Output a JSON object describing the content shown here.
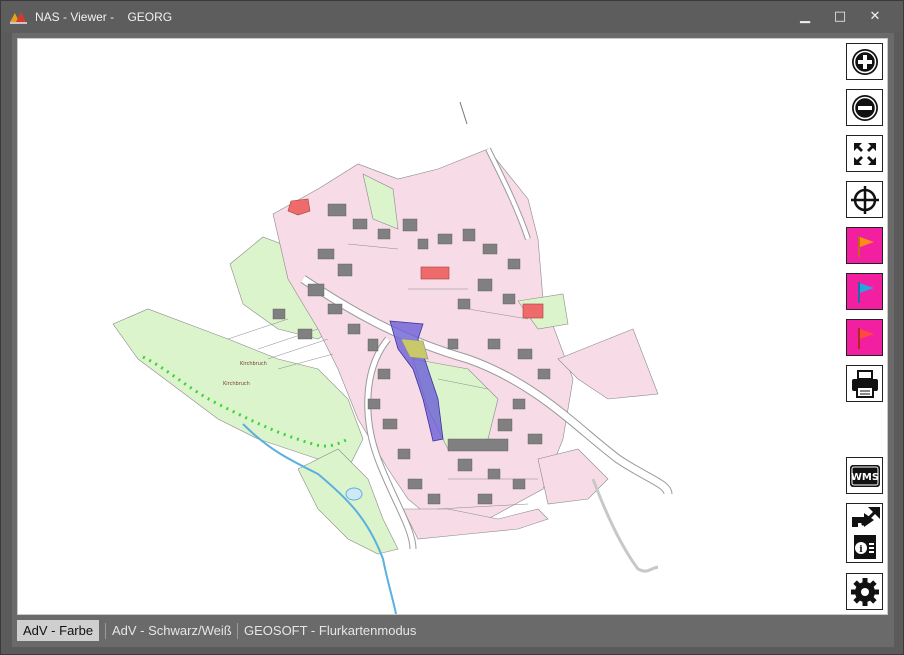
{
  "window": {
    "title": "NAS - Viewer -    GEORG",
    "minimize_glyph": "▁",
    "maximize_glyph": "□",
    "close_glyph": "✕"
  },
  "map": {
    "labels": {
      "field_1": "Kirchbruch",
      "field_2": "Kirchbruch"
    },
    "colors": {
      "residential": "#f7dbe6",
      "green": "#dcf4cc",
      "building": "#808080",
      "public_building": "#ef6b6b",
      "road": "#ffffff",
      "highlight": "#6b5fd6",
      "water": "#5ab0e0",
      "hedge": "#39d639"
    }
  },
  "toolbar": {
    "buttons": [
      {
        "name": "zoom-in",
        "icon": "plus-circle-icon"
      },
      {
        "name": "zoom-out",
        "icon": "minus-circle-icon"
      },
      {
        "name": "fit-extent",
        "icon": "expand-arrows-icon"
      },
      {
        "name": "locate",
        "icon": "crosshair-icon"
      },
      {
        "name": "flag-orange",
        "icon": "flag-orange-icon",
        "color": "#ff8c1a"
      },
      {
        "name": "flag-blue",
        "icon": "flag-blue-icon",
        "color": "#2f9fe0"
      },
      {
        "name": "flag-red",
        "icon": "flag-red-icon",
        "color": "#ff4a3d"
      },
      {
        "name": "print",
        "icon": "printer-icon"
      },
      {
        "name": "wms",
        "icon": "wms-icon",
        "label": "WMS"
      },
      {
        "name": "export-info",
        "icon": "export-info-icon"
      },
      {
        "name": "settings",
        "icon": "gear-icon"
      }
    ]
  },
  "tabs": [
    {
      "label": "AdV - Farbe",
      "active": true
    },
    {
      "label": "AdV - Schwarz/Weiß",
      "active": false
    },
    {
      "label": "GEOSOFT - Flurkartenmodus",
      "active": false
    }
  ]
}
